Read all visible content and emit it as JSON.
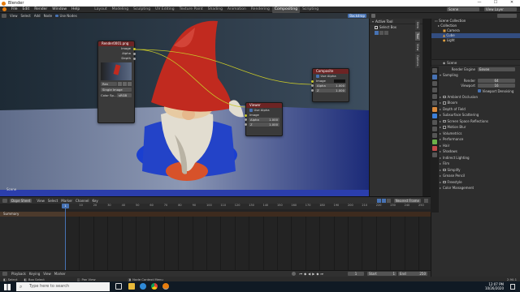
{
  "window": {
    "title": "Blender",
    "controls": [
      "—",
      "☐",
      "✕"
    ]
  },
  "menu": {
    "items": [
      "File",
      "Edit",
      "Render",
      "Window",
      "Help"
    ],
    "workspaces": [
      "Layout",
      "Modeling",
      "Sculpting",
      "UV Editing",
      "Texture Paint",
      "Shading",
      "Animation",
      "Rendering",
      "Compositing",
      "Scripting"
    ],
    "active_workspace": "Compositing",
    "scene_label": "Scene",
    "view_layer_label": "View Layer"
  },
  "viewport_header": {
    "items": [
      "View",
      "Select",
      "Add",
      "Node"
    ],
    "use_nodes_label": "Use Nodes",
    "backdrop_label": "Backdrop"
  },
  "viewport": {
    "scene_label": "Scene"
  },
  "nodes": {
    "render_layers": {
      "title": "Render0001.png",
      "outputs": [
        "Image",
        "Alpha",
        "Depth"
      ],
      "image_name": "Ren",
      "source": "Single Image",
      "color_space_label": "Color Sp...",
      "color_space_value": "sRGB"
    },
    "viewer": {
      "title": "Viewer",
      "use_alpha_label": "Use Alpha",
      "inputs": [
        "Image"
      ],
      "alpha_label": "Alpha",
      "alpha_value": "1.000",
      "z_label": "Z",
      "z_value": "1.000"
    },
    "composite": {
      "title": "Composite",
      "use_alpha_label": "Use Alpha",
      "inputs": [
        "Image"
      ],
      "alpha_label": "Alpha",
      "alpha_value": "1.000",
      "z_label": "Z",
      "z_value": "1.000"
    }
  },
  "tool_panel": {
    "active_tool_label": "Active Tool",
    "select_box_label": "Select Box",
    "side_tabs": [
      "Item",
      "Tool",
      "View",
      "Options"
    ]
  },
  "outliner": {
    "rows": [
      {
        "label": "Scene Collection",
        "selected": false
      },
      {
        "label": "Collection",
        "selected": false
      },
      {
        "label": "Camera",
        "selected": false
      },
      {
        "label": "Cube",
        "selected": true
      },
      {
        "label": "Light",
        "selected": false
      }
    ]
  },
  "properties": {
    "scene_label": "Scene",
    "render_engine_label": "Render Engine",
    "render_engine_value": "Eevee",
    "sampling_label": "Sampling",
    "render_label": "Render",
    "render_value": "64",
    "viewport_label": "Viewport",
    "viewport_value": "16",
    "viewport_denoising_label": "Viewport Denoising",
    "sections": [
      "Ambient Occlusion",
      "Bloom",
      "Depth of Field",
      "Subsurface Scattering",
      "Screen Space Reflections",
      "Motion Blur",
      "Volumetrics",
      "Performance",
      "Hair",
      "Shadows",
      "Indirect Lighting",
      "Film",
      "Simplify",
      "Grease Pencil",
      "Freestyle",
      "Color Management"
    ],
    "checkable_sections": [
      "Ambient Occlusion",
      "Bloom",
      "Screen Space Reflections",
      "Motion Blur",
      "Simplify",
      "Freestyle"
    ],
    "accent_color": "#4772b3"
  },
  "timeline": {
    "header_items": [
      "Dope Sheet",
      "View",
      "Select",
      "Marker",
      "Channel",
      "Key"
    ],
    "nearest_frame_label": "Nearest Frame",
    "summary_label": "Summary",
    "ruler_ticks": [
      "0",
      "10",
      "20",
      "30",
      "40",
      "50",
      "60",
      "70",
      "80",
      "90",
      "100",
      "110",
      "120",
      "130",
      "140",
      "150",
      "160",
      "170",
      "180",
      "190",
      "200",
      "210",
      "220",
      "230",
      "240",
      "250"
    ],
    "current_frame": "1"
  },
  "playback": {
    "items": [
      "Playback",
      "Keying",
      "View",
      "Marker"
    ],
    "start_label": "Start",
    "start_value": "1",
    "end_label": "End",
    "end_value": "250",
    "frame_value": "1"
  },
  "statusbar": {
    "select_label": "Select",
    "box_select_label": "Box Select",
    "pan_label": "Pan View",
    "context_label": "Node Context Menu",
    "version": "2.90.1"
  },
  "taskbar": {
    "search_placeholder": "Type here to search",
    "time": "12:07 PM",
    "date": "10/26/2020"
  }
}
